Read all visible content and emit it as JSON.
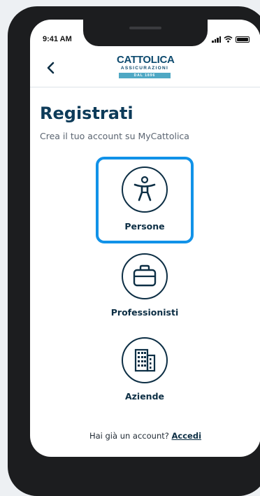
{
  "status_bar": {
    "time": "9:41 AM"
  },
  "header": {
    "logo_main": "CATTOLICA",
    "logo_sub": "ASSICURAZIONI",
    "logo_since": "DAL 1896"
  },
  "page": {
    "title": "Registrati",
    "subtitle": "Crea il tuo account su MyCattolica"
  },
  "options": [
    {
      "label": "Persone",
      "icon": "accessibility-person-icon",
      "selected": true
    },
    {
      "label": "Professionisti",
      "icon": "briefcase-icon",
      "selected": false
    },
    {
      "label": "Aziende",
      "icon": "building-icon",
      "selected": false
    }
  ],
  "footer": {
    "prompt": "Hai già un account?",
    "link": "Accedi"
  },
  "colors": {
    "accent": "#1192e8",
    "brand_dark": "#0d3b59",
    "icon_stroke": "#0d2f45"
  }
}
